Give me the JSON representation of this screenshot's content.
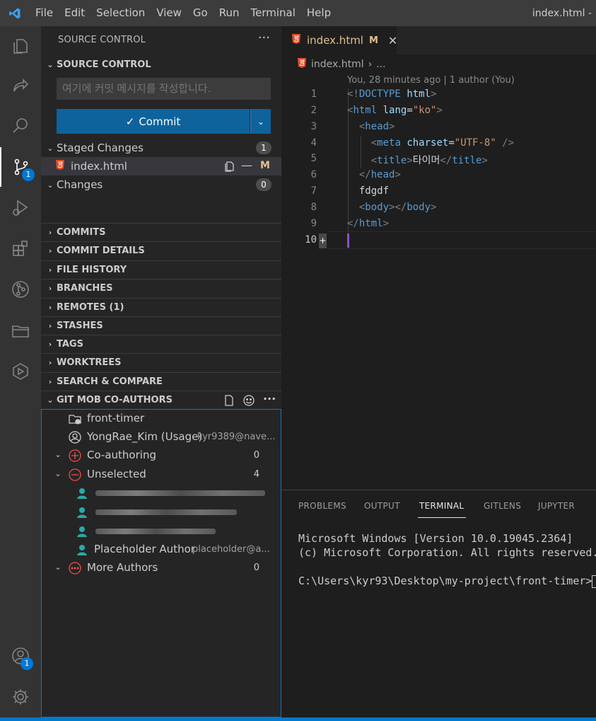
{
  "titlebar": {
    "menu": [
      "File",
      "Edit",
      "Selection",
      "View",
      "Go",
      "Run",
      "Terminal",
      "Help"
    ],
    "window_title": "index.html -"
  },
  "activitybar": {
    "scm_badge": "1",
    "accounts_badge": "1"
  },
  "sidebar": {
    "title": "SOURCE CONTROL",
    "more": "···",
    "scm_section": "SOURCE CONTROL",
    "commit_placeholder": "여기에 커밋 메시지를 작성합니다.",
    "commit_label": "Commit",
    "staged": {
      "label": "Staged Changes",
      "count": "1"
    },
    "staged_file": {
      "name": "index.html",
      "status": "M"
    },
    "changes": {
      "label": "Changes",
      "count": "0"
    },
    "sections": [
      "COMMITS",
      "COMMIT DETAILS",
      "FILE HISTORY",
      "BRANCHES",
      "REMOTES (1)",
      "STASHES",
      "TAGS",
      "WORKTREES",
      "SEARCH & COMPARE"
    ],
    "gitmob": {
      "title": "GIT MOB CO-AUTHORS",
      "repo": "front-timer",
      "user_name": "YongRae_Kim (Usage)",
      "user_email": "kyr9389@nave...",
      "coauthoring": {
        "label": "Co-authoring",
        "count": "0"
      },
      "unselected": {
        "label": "Unselected",
        "count": "4"
      },
      "placeholder_name": "Placeholder Author",
      "placeholder_email": "placeholder@a...",
      "more_authors": {
        "label": "More Authors",
        "count": "0"
      }
    }
  },
  "editor": {
    "tab": {
      "name": "index.html",
      "status": "M"
    },
    "breadcrumb": {
      "file": "index.html",
      "rest": "..."
    },
    "blame": "You, 28 minutes ago | 1 author (You)",
    "line_numbers": [
      "1",
      "2",
      "3",
      "4",
      "5",
      "6",
      "7",
      "8",
      "9",
      "10"
    ],
    "code": {
      "l1": {
        "open": "<!",
        "kw": "DOCTYPE",
        "attr": "html",
        "close": ">"
      },
      "l2": {
        "tag": "html",
        "attr": "lang",
        "val": "\"ko\""
      },
      "l3": {
        "tag": "head"
      },
      "l4": {
        "tag": "meta",
        "attr": "charset",
        "val": "\"UTF-8\"",
        "end": "/>"
      },
      "l5": {
        "tag": "title",
        "text": "타이머"
      },
      "l6": {
        "tag": "head"
      },
      "l7": {
        "text": "fdgdf"
      },
      "l8": {
        "tag": "body"
      },
      "l9": {
        "tag": "html"
      }
    }
  },
  "panel": {
    "tabs": [
      "PROBLEMS",
      "OUTPUT",
      "TERMINAL",
      "GITLENS",
      "JUPYTER"
    ],
    "terminal_lines": [
      "Microsoft Windows [Version 10.0.19045.2364]",
      "(c) Microsoft Corporation. All rights reserved.",
      "C:\\Users\\kyr93\\Desktop\\my-project\\front-timer>"
    ]
  }
}
